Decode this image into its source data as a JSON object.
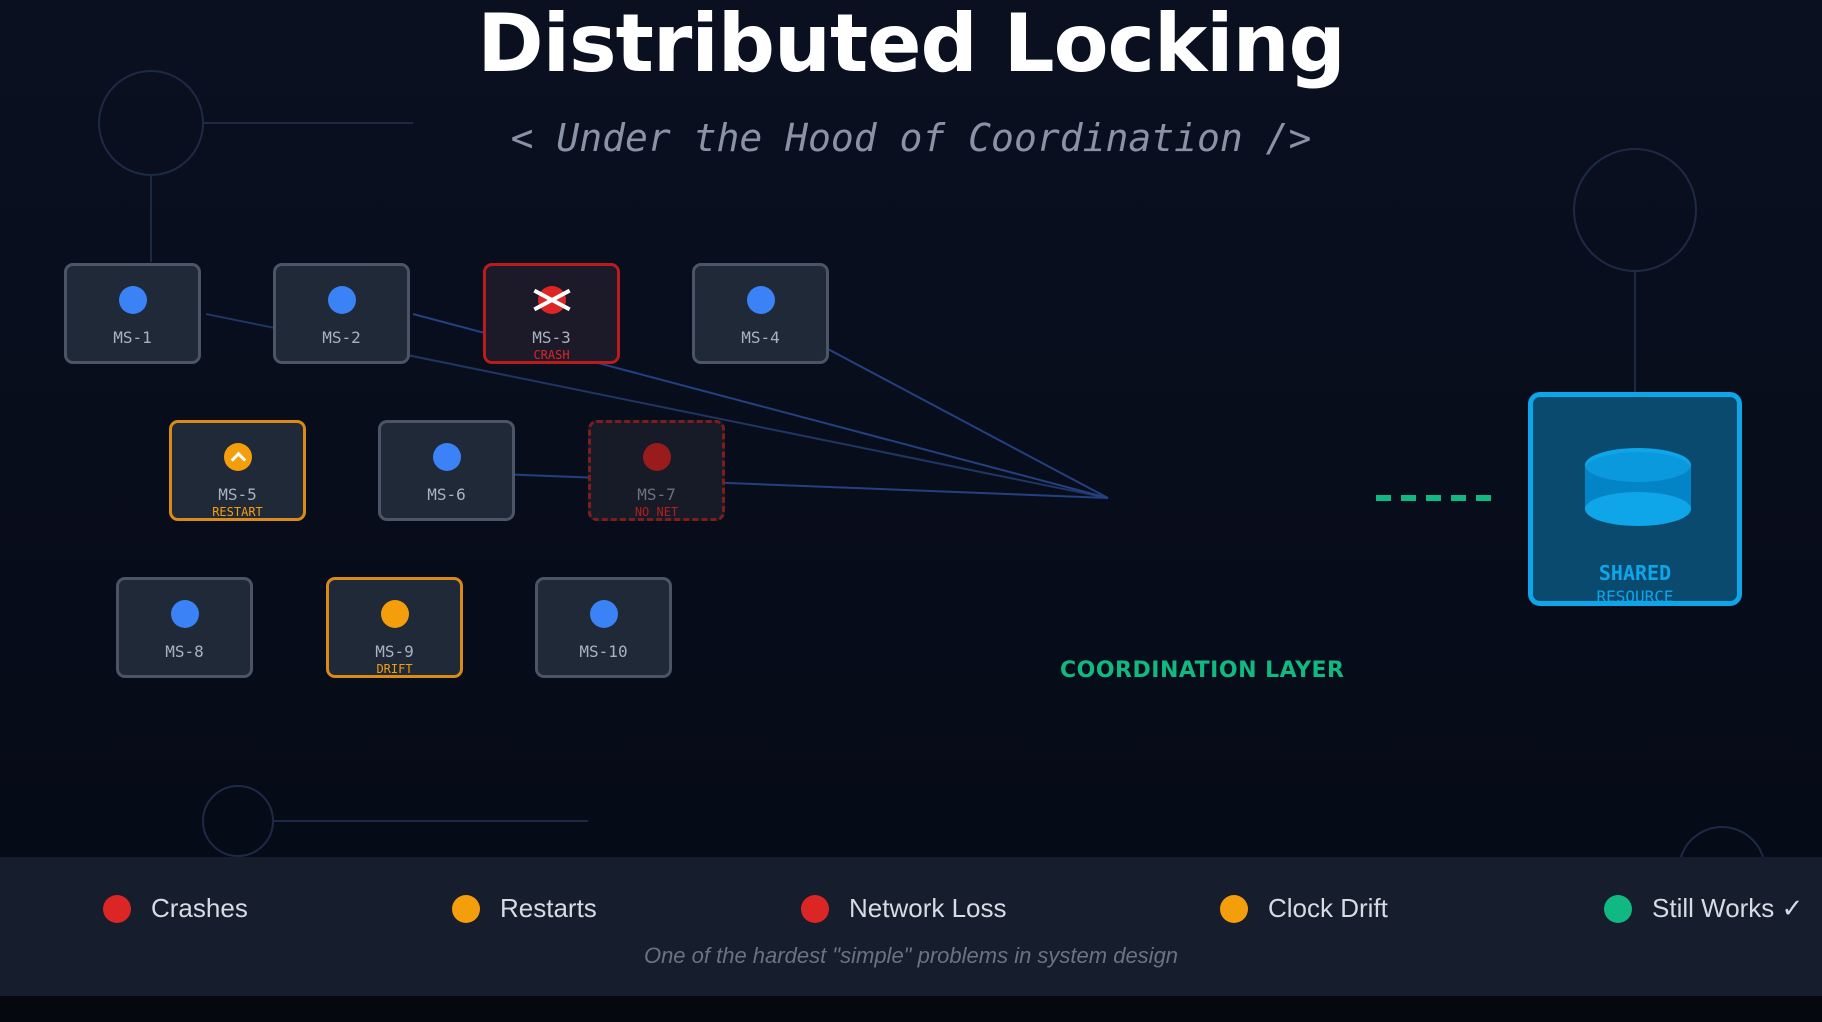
{
  "title": "Distributed Locking",
  "subtitle": "< Under the Hood of Coordination />",
  "nodes": [
    {
      "label": "MS-1",
      "status": "",
      "state": "ok"
    },
    {
      "label": "MS-2",
      "status": "",
      "state": "ok"
    },
    {
      "label": "MS-3",
      "status": "CRASH",
      "state": "crash"
    },
    {
      "label": "MS-4",
      "status": "",
      "state": "ok"
    },
    {
      "label": "MS-5",
      "status": "RESTART",
      "state": "restart"
    },
    {
      "label": "MS-6",
      "status": "",
      "state": "ok"
    },
    {
      "label": "MS-7",
      "status": "NO NET",
      "state": "nonet"
    },
    {
      "label": "MS-8",
      "status": "",
      "state": "ok"
    },
    {
      "label": "MS-9",
      "status": "DRIFT",
      "state": "drift"
    },
    {
      "label": "MS-10",
      "status": "",
      "state": "ok"
    }
  ],
  "coordination": {
    "label": "COORDINATION LAYER"
  },
  "resource": {
    "title": "SHARED",
    "subtitle": "RESOURCE"
  },
  "legend": [
    {
      "label": "Crashes",
      "color": "#dc2626"
    },
    {
      "label": "Restarts",
      "color": "#f59e0b"
    },
    {
      "label": "Network Loss",
      "color": "#dc2626"
    },
    {
      "label": "Clock Drift",
      "color": "#f59e0b"
    },
    {
      "label": "Still Works ✓",
      "color": "#10b981"
    }
  ],
  "tagline": "One of the hardest \"simple\" problems in system design",
  "colors": {
    "ok": "#3b82f6",
    "crash": "#dc2626",
    "warning": "#f59e0b",
    "success": "#10b981",
    "resource": "#0ea5e9",
    "connector": "#2c4a82"
  }
}
